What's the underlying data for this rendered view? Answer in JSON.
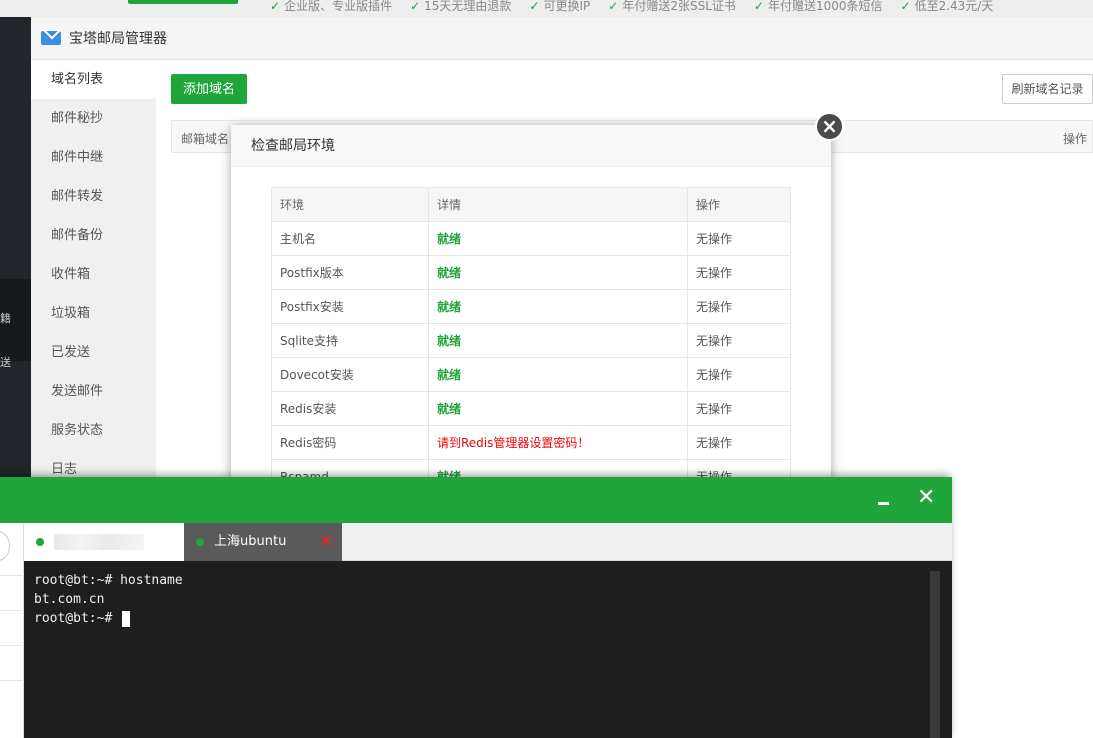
{
  "promos": [
    "企业版、专业版插件",
    "15天无理由退款",
    "可更换IP",
    "年付赠送2张SSL证书",
    "年付赠送1000条短信",
    "低至2.43元/天"
  ],
  "sidebar_glyphs": [
    "",
    "籍",
    "送"
  ],
  "window": {
    "title": "宝塔邮局管理器"
  },
  "menu": [
    "域名列表",
    "邮件秘抄",
    "邮件中继",
    "邮件转发",
    "邮件备份",
    "收件箱",
    "垃圾箱",
    "已发送",
    "发送邮件",
    "服务状态",
    "日志"
  ],
  "content": {
    "add_label": "添加域名",
    "refresh_label": "刷新域名记录",
    "col_domain": "邮箱域名",
    "col_op": "操作"
  },
  "modal": {
    "title": "检查邮局环境",
    "headers": [
      "环境",
      "详情",
      "操作"
    ],
    "rows": [
      {
        "env": "主机名",
        "detail": "就绪",
        "op": "无操作"
      },
      {
        "env": "Postfix版本",
        "detail": "就绪",
        "op": "无操作"
      },
      {
        "env": "Postfix安装",
        "detail": "就绪",
        "op": "无操作"
      },
      {
        "env": "Sqlite支持",
        "detail": "就绪",
        "op": "无操作"
      },
      {
        "env": "Dovecot安装",
        "detail": "就绪",
        "op": "无操作"
      },
      {
        "env": "Redis安装",
        "detail": "就绪",
        "op": "无操作"
      },
      {
        "env": "Redis密码",
        "detail": "请到Redis管理器设置密码！",
        "op": "无操作"
      },
      {
        "env": "Rspamd",
        "detail": "就绪",
        "op": "无操作"
      }
    ]
  },
  "terminal": {
    "tab2_label": "上海ubuntu",
    "lines": [
      "root@bt:~# hostname",
      "bt.com.cn",
      "root@bt:~# "
    ]
  }
}
